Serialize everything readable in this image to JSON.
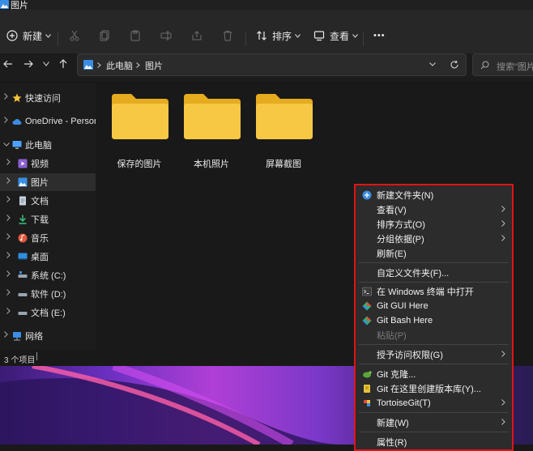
{
  "window": {
    "title": "图片"
  },
  "toolbar": {
    "new_label": "新建",
    "sort_label": "排序",
    "view_label": "查看",
    "more_label": "•••"
  },
  "address": {
    "crumbs": [
      "此电脑",
      "图片"
    ],
    "search_placeholder": "搜索\"图片"
  },
  "sidebar": {
    "items": [
      {
        "label": "快速访问",
        "icon": "star-icon"
      },
      {
        "label": "OneDrive - Persona",
        "icon": "cloud-icon"
      },
      {
        "label": "此电脑",
        "icon": "monitor-icon"
      },
      {
        "label": "视频",
        "icon": "video-icon"
      },
      {
        "label": "图片",
        "icon": "pictures-icon"
      },
      {
        "label": "文档",
        "icon": "documents-icon"
      },
      {
        "label": "下载",
        "icon": "download-icon"
      },
      {
        "label": "音乐",
        "icon": "music-icon"
      },
      {
        "label": "桌面",
        "icon": "desktop-icon"
      },
      {
        "label": "系统 (C:)",
        "icon": "drive-icon"
      },
      {
        "label": "软件 (D:)",
        "icon": "drive-icon"
      },
      {
        "label": "文档 (E:)",
        "icon": "drive-icon"
      },
      {
        "label": "网络",
        "icon": "network-icon"
      }
    ]
  },
  "folders": [
    {
      "label": "保存的图片"
    },
    {
      "label": "本机照片"
    },
    {
      "label": "屏幕截图"
    }
  ],
  "status": {
    "item_count": "3 个项目"
  },
  "context_menu": {
    "items": [
      {
        "label": "新建文件夹(N)",
        "icon": "new-folder-icon"
      },
      {
        "label": "查看(V)",
        "submenu": true
      },
      {
        "label": "排序方式(O)",
        "submenu": true
      },
      {
        "label": "分组依据(P)",
        "submenu": true
      },
      {
        "label": "刷新(E)"
      },
      {
        "label": "自定义文件夹(F)..."
      },
      {
        "label": "在 Windows 终端 中打开",
        "icon": "terminal-icon"
      },
      {
        "label": "Git GUI Here",
        "icon": "git-icon"
      },
      {
        "label": "Git Bash Here",
        "icon": "git-icon"
      },
      {
        "label": "粘贴(P)",
        "disabled": true
      },
      {
        "label": "授予访问权限(G)",
        "submenu": true
      },
      {
        "label": "Git 克隆...",
        "icon": "tortoisegit-icon"
      },
      {
        "label": "Git 在这里创建版本库(Y)...",
        "icon": "tortoisegit-icon"
      },
      {
        "label": "TortoiseGit(T)",
        "icon": "tortoisegit-icon",
        "submenu": true
      },
      {
        "label": "新建(W)",
        "submenu": true
      },
      {
        "label": "属性(R)"
      }
    ]
  },
  "colors": {
    "accent": "#4ea1ff",
    "folder": "#f7c844",
    "highlight_border": "#e01414"
  }
}
